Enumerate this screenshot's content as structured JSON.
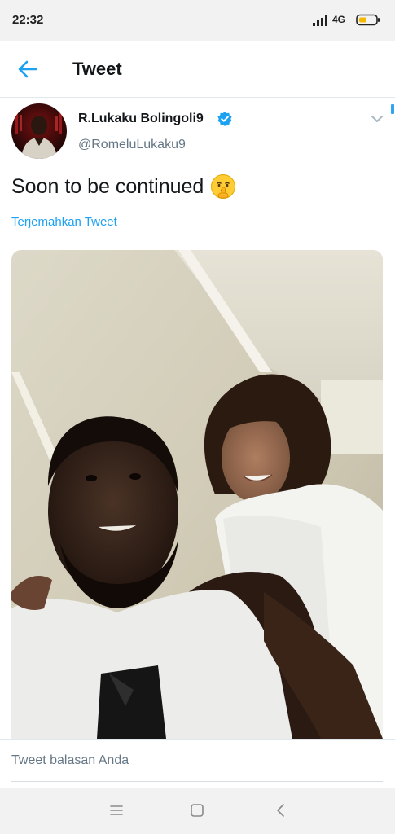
{
  "status_bar": {
    "time": "22:32",
    "network": "4G",
    "signal_icon": "signal-bars-icon",
    "battery_icon": "battery-icon"
  },
  "header": {
    "back_icon": "arrow-left-icon",
    "title": "Tweet"
  },
  "tweet": {
    "author_name": "R.Lukaku Bolingoli9",
    "verified_icon": "verified-badge-icon",
    "handle": "@RomeluLukaku9",
    "text": "Soon to be continued",
    "emoji": "shushing-face-emoji",
    "translate_label": "Terjemahkan Tweet",
    "menu_icon": "chevron-down-icon",
    "photo": "selfie-photo"
  },
  "reply": {
    "placeholder": "Tweet balasan Anda"
  },
  "nav_bar": {
    "menu_icon": "menu-lines-icon",
    "home_icon": "home-square-icon",
    "back_icon": "back-triangle-icon"
  },
  "colors": {
    "accent": "#1da1f2",
    "text_primary": "#14171a",
    "text_secondary": "#657786",
    "system_bar": "#f2f2f2"
  }
}
